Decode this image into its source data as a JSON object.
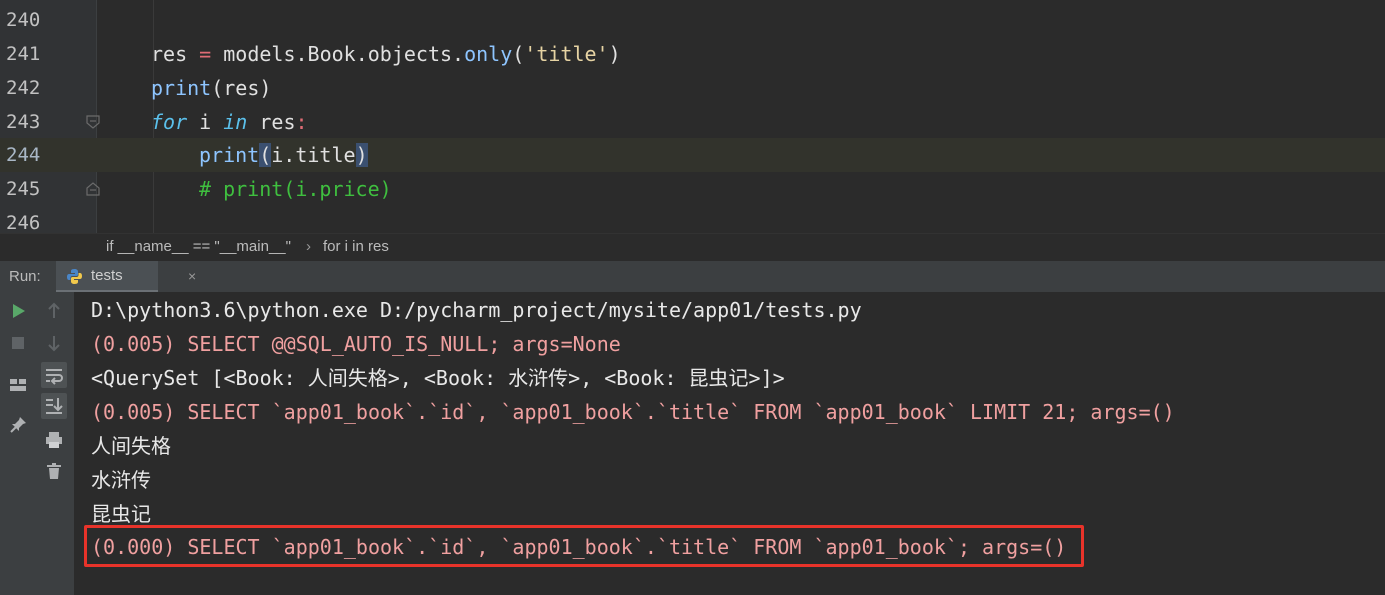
{
  "editor": {
    "lines": [
      {
        "number": "240",
        "tokens": []
      },
      {
        "number": "241",
        "tokens": [
          {
            "t": "res",
            "c": "tok-id"
          },
          {
            "t": " = ",
            "c": "tok-op"
          },
          {
            "t": "models.Book.objects.",
            "c": "tok-id"
          },
          {
            "t": "only",
            "c": "kw-builtin"
          },
          {
            "t": "(",
            "c": "tok-id"
          },
          {
            "t": "'title'",
            "c": "tok-str"
          },
          {
            "t": ")",
            "c": "tok-id"
          }
        ]
      },
      {
        "number": "242",
        "tokens": [
          {
            "t": "print",
            "c": "kw-builtin"
          },
          {
            "t": "(res)",
            "c": "tok-id"
          }
        ]
      },
      {
        "number": "243",
        "tokens": [
          {
            "t": "for",
            "c": "tok-kw"
          },
          {
            "t": " i ",
            "c": "tok-id"
          },
          {
            "t": "in",
            "c": "tok-kw"
          },
          {
            "t": " res",
            "c": "tok-id"
          },
          {
            "t": ":",
            "c": "tok-op"
          }
        ]
      },
      {
        "number": "244",
        "tokens": [
          {
            "t": "print",
            "c": "kw-builtin"
          },
          {
            "t": "(",
            "c": "tok-id bracket-hl"
          },
          {
            "t": "i.title",
            "c": "tok-id"
          },
          {
            "t": ")",
            "c": "tok-id bracket-hl"
          }
        ]
      },
      {
        "number": "245",
        "tokens": [
          {
            "t": "# print(i.price)",
            "c": "tok-comment"
          }
        ]
      },
      {
        "number": "246",
        "tokens": []
      }
    ]
  },
  "breadcrumb": {
    "items": [
      "if __name__ == \"__main__\"",
      "for i in res"
    ],
    "separator": "›"
  },
  "run_panel": {
    "label": "Run:",
    "tab_label": "tests",
    "tab_close": "×"
  },
  "console": {
    "lines": [
      {
        "text": "D:\\python3.6\\python.exe D:/pycharm_project/mysite/app01/tests.py",
        "kind": "normal"
      },
      {
        "text": "(0.005) SELECT @@SQL_AUTO_IS_NULL; args=None",
        "kind": "sql"
      },
      {
        "text": "<QuerySet [<Book: 人间失格>, <Book: 水浒传>, <Book: 昆虫记>]>",
        "kind": "normal"
      },
      {
        "text": "(0.005) SELECT `app01_book`.`id`, `app01_book`.`title` FROM `app01_book` LIMIT 21; args=()",
        "kind": "sql"
      },
      {
        "text": "人间失格",
        "kind": "normal"
      },
      {
        "text": "水浒传",
        "kind": "normal"
      },
      {
        "text": "昆虫记",
        "kind": "normal"
      },
      {
        "text": "(0.000) SELECT `app01_book`.`id`, `app01_book`.`title` FROM `app01_book`; args=()",
        "kind": "sql"
      }
    ]
  },
  "colors": {
    "accent_highlight": "#e8332a",
    "run_green": "#59a869",
    "sql_text": "#f0a0a0"
  },
  "icons": {
    "toolbar": [
      "run-icon",
      "stop-icon",
      "layout-icon",
      "pin-icon",
      "up-arrow-icon",
      "down-arrow-icon",
      "soft-wrap-icon",
      "scroll-to-end-icon",
      "print-icon",
      "trash-icon"
    ]
  }
}
